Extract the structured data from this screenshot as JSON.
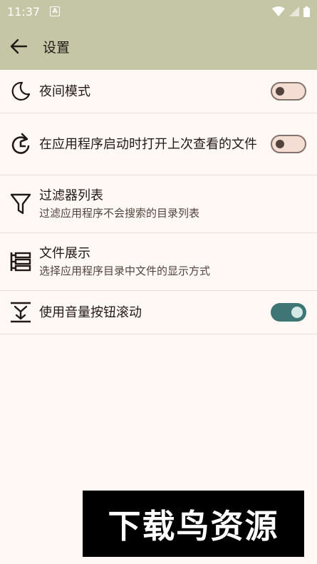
{
  "status_bar": {
    "time": "11:37",
    "notification_letter": "A",
    "icons": [
      "wifi-icon",
      "signal-icon",
      "battery-icon"
    ]
  },
  "app_bar": {
    "title": "设置",
    "back_icon": "arrow-left-icon"
  },
  "settings": [
    {
      "id": "dark-mode",
      "icon": "moon-icon",
      "title": "夜间模式",
      "subtitle": "",
      "toggle": "off"
    },
    {
      "id": "reopen-last-file",
      "icon": "restart-icon",
      "title": "在应用程序启动时打开上次查看的文件",
      "subtitle": "",
      "toggle": "off"
    },
    {
      "id": "filter-list",
      "icon": "filter-icon",
      "title": "过滤器列表",
      "subtitle": "过滤应用程序不会搜索的目录列表",
      "toggle": null
    },
    {
      "id": "file-display",
      "icon": "list-view-icon",
      "title": "文件展示",
      "subtitle": "选择应用程序目录中文件的显示方式",
      "toggle": null
    },
    {
      "id": "volume-scroll",
      "icon": "volume-scroll-icon",
      "title": "使用音量按钮滚动",
      "subtitle": "",
      "toggle": "on"
    }
  ],
  "watermark": {
    "text": "下载鸟资源"
  },
  "colors": {
    "app_bar": "#c4c6a6",
    "background": "#fff8f5",
    "switch_on": "#3f7574",
    "switch_off_track": "#f4ded4",
    "divider": "#e4ddd8"
  }
}
